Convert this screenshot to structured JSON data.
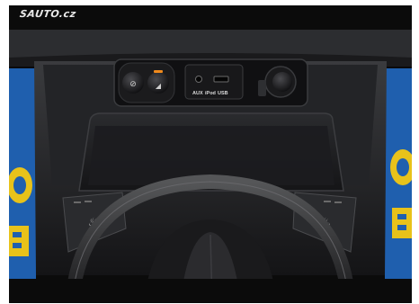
{
  "watermark": "SAUTO.cz",
  "ports": {
    "aux": "AUX",
    "ipod": "iPod",
    "usb": "USB"
  },
  "colors": {
    "background": "#0b0b0b",
    "console": "#1c1c1e",
    "tray": "#202023",
    "blue_seat_upholstery": "#1f5fae",
    "yellow_graphic": "#e8c21a",
    "indicator_led": "#f08a1c"
  },
  "icons": [
    "esp-off-icon",
    "hill-descent-icon",
    "power-outlet-icon",
    "seat-heater-icon"
  ]
}
